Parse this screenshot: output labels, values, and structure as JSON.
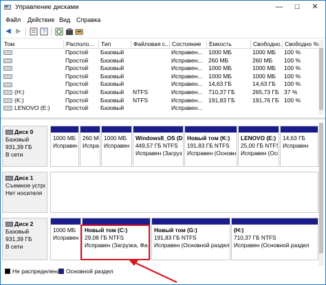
{
  "window": {
    "title": "Управление дисками",
    "minimize": "—",
    "maximize": "☐",
    "close": "✕"
  },
  "menu": [
    "Файл",
    "Действие",
    "Вид",
    "Справка"
  ],
  "toolbar_icons": [
    "back-arrow-icon",
    "forward-arrow-icon",
    "properties-icon",
    "help-icon",
    "refresh-icon",
    "rescan-icon",
    "disk-properties-icon"
  ],
  "table": {
    "headers": [
      "Том",
      "Располо...",
      "Тип",
      "Файловая с...",
      "Состояние",
      "Емкость",
      "Свободно...",
      "Свободно %"
    ],
    "rows": [
      [
        "",
        "Простой",
        "Базовый",
        "",
        "Исправен...",
        "1000 МБ",
        "1000 МБ",
        "100 %"
      ],
      [
        "",
        "Простой",
        "Базовый",
        "",
        "Исправен...",
        "260 МБ",
        "260 МБ",
        "100 %"
      ],
      [
        "",
        "Простой",
        "Базовый",
        "",
        "Исправен...",
        "1000 МБ",
        "1000 МБ",
        "100 %"
      ],
      [
        "",
        "Простой",
        "Базовый",
        "",
        "Исправен...",
        "1000 МБ",
        "1000 МБ",
        "100 %"
      ],
      [
        "",
        "Простой",
        "Базовый",
        "",
        "Исправен...",
        "14,63 ГБ",
        "14,63 ГБ",
        "100 %"
      ],
      [
        "(H:)",
        "Простой",
        "Базовый",
        "NTFS",
        "Исправен...",
        "710,37 ГБ",
        "265,73 ГБ",
        "37 %"
      ],
      [
        "(K:)",
        "Простой",
        "Базовый",
        "NTFS",
        "Исправен...",
        "191,83 ГБ",
        "191,76 ГБ",
        "100 %"
      ],
      [
        "LENOVO (E:)",
        "Простой",
        "Базовый",
        "",
        "Исправен...",
        "",
        "",
        ""
      ]
    ]
  },
  "disks": [
    {
      "name": "Диск 0",
      "type": "Базовый",
      "size": "931,39 ГБ",
      "status": "В сети",
      "partitions": [
        {
          "title": "",
          "line1": "1000 МБ",
          "line2": "Исправен"
        },
        {
          "title": "",
          "line1": "260 МБ",
          "line2": "Исправен"
        },
        {
          "title": "",
          "line1": "1000 МБ",
          "line2": "Исправен"
        },
        {
          "title": "Windows8_OS  (D",
          "line1": "449,57 ГБ NTFS",
          "line2": "Исправен (Загрузк"
        },
        {
          "title": "Новый том  (K:)",
          "line1": "191,83 ГБ NTFS",
          "line2": "Исправен (Основной"
        },
        {
          "title": "LENOVO  (E:)",
          "line1": "25,00 ГБ NTFS",
          "line2": "Исправен (Осно"
        },
        {
          "title": "",
          "line1": "14,63 ГБ",
          "line2": "Исправен"
        }
      ]
    },
    {
      "name": "Диск 1",
      "type": "Съемное устро",
      "size": "",
      "status": "Нет носителя",
      "partitions": []
    },
    {
      "name": "Диск 2",
      "type": "Базовый",
      "size": "931,39 ГБ",
      "status": "В сети",
      "partitions": [
        {
          "title": "",
          "line1": "1000 МБ",
          "line2": "Исправен"
        },
        {
          "title": "Новый том  (C:)",
          "line1": "29,08 ГБ NTFS",
          "line2": "Исправен (Загрузка, Фа"
        },
        {
          "title": "Новый том  (G:)",
          "line1": "191,83 ГБ NTFS",
          "line2": "Исправен (Основной раздел"
        },
        {
          "title": "(H:)",
          "line1": "710,37 ГБ NTFS",
          "line2": "Исправен (Основной раздел"
        }
      ]
    }
  ],
  "legend": {
    "unallocated": "Не распределена",
    "primary": "Основной раздел"
  },
  "colors": {
    "primary": "#1a1c8c",
    "highlight": "#d9141e",
    "window_border": "#1e74c8"
  }
}
